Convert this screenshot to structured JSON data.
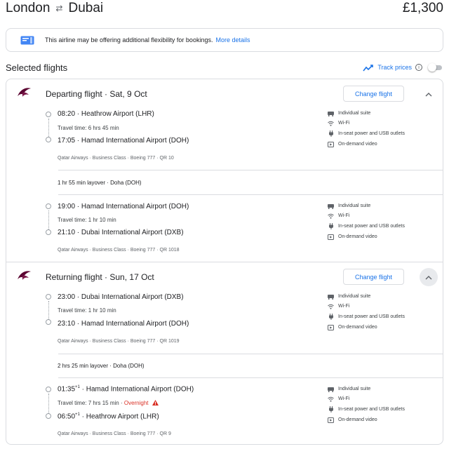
{
  "header": {
    "origin": "London",
    "destination": "Dubai",
    "price": "£1,300"
  },
  "notice": {
    "text": "This airline may be offering additional flexibility for bookings.",
    "link": "More details"
  },
  "selected": {
    "title": "Selected flights",
    "track_label": "Track prices",
    "track_enabled": false
  },
  "amenities": [
    "Individual suite",
    "Wi-Fi",
    "In-seat power and USB outlets",
    "On-demand video"
  ],
  "departing": {
    "title": "Departing flight · Sat, 9 Oct",
    "change_label": "Change flight",
    "seg1": {
      "dep_time": "08:20",
      "dep_airport": "Heathrow Airport (LHR)",
      "travel": "Travel time: 6 hrs 45 min",
      "arr_time": "17:05",
      "arr_airport": "Hamad International Airport (DOH)",
      "meta": "Qatar Airways · Business Class · Boeing 777 · QR 10"
    },
    "layover": "1 hr 55 min layover · Doha (DOH)",
    "seg2": {
      "dep_time": "19:00",
      "dep_airport": "Hamad International Airport (DOH)",
      "travel": "Travel time: 1 hr 10 min",
      "arr_time": "21:10",
      "arr_airport": "Dubai International Airport (DXB)",
      "meta": "Qatar Airways · Business Class · Boeing 777 · QR 1018"
    }
  },
  "returning": {
    "title": "Returning flight · Sun, 17 Oct",
    "change_label": "Change flight",
    "seg1": {
      "dep_time": "23:00",
      "dep_airport": "Dubai International Airport (DXB)",
      "travel": "Travel time: 1 hr 10 min",
      "arr_time": "23:10",
      "arr_airport": "Hamad International Airport (DOH)",
      "meta": "Qatar Airways · Business Class · Boeing 777 · QR 1019"
    },
    "layover": "2 hrs 25 min layover · Doha (DOH)",
    "seg2": {
      "dep_time": "01:35",
      "dep_sup": "+1",
      "dep_airport": "Hamad International Airport (DOH)",
      "travel": "Travel time: 7 hrs 15 min",
      "overnight": "Overnight",
      "arr_time": "06:50",
      "arr_sup": "+1",
      "arr_airport": "Heathrow Airport (LHR)",
      "meta": "Qatar Airways · Business Class · Boeing 777 · QR 9"
    }
  },
  "colors": {
    "link": "#1a73e8",
    "warning": "#d93025",
    "airline": "#5c0632",
    "border": "#dadce0"
  },
  "icons": [
    "swap-icon",
    "ticket-icon",
    "trend-icon",
    "info-icon",
    "airline-logo",
    "chevron-up-icon",
    "seat-icon",
    "wifi-icon",
    "power-icon",
    "video-icon",
    "warning-icon"
  ]
}
